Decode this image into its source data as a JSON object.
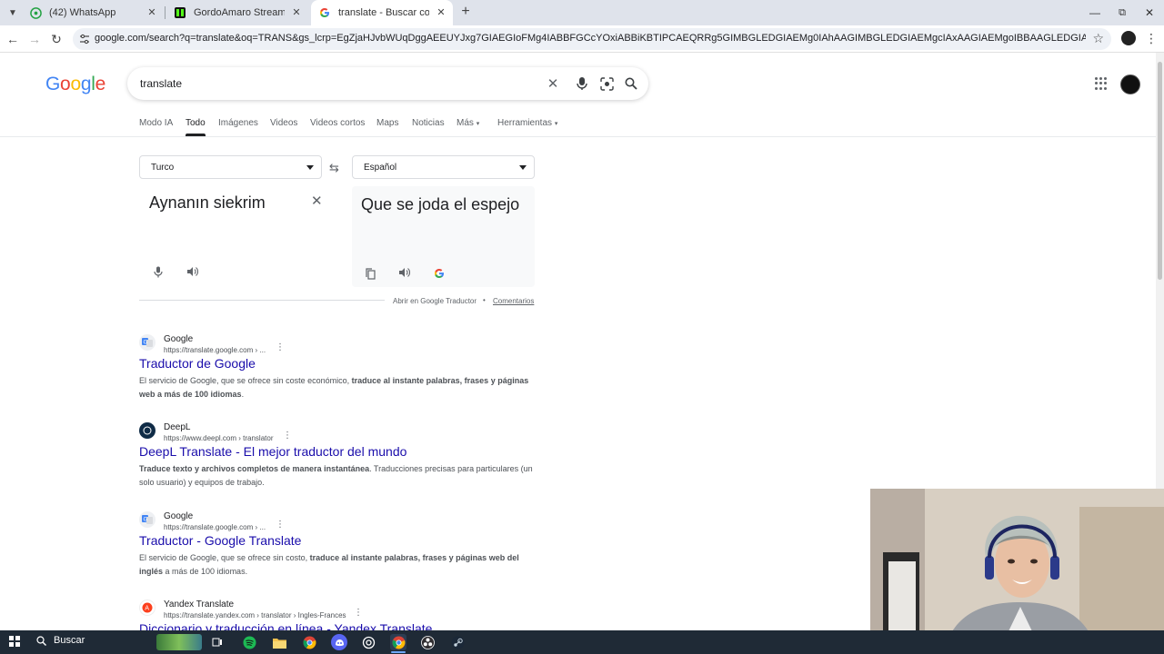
{
  "browser": {
    "tabs": [
      {
        "label": "(42) WhatsApp",
        "active": false,
        "icon": "whatsapp-icon"
      },
      {
        "label": "GordoAmaro Stream - Watch Li",
        "active": false,
        "icon": "kick-icon"
      },
      {
        "label": "translate - Buscar con Google",
        "active": true,
        "icon": "google-icon"
      }
    ],
    "url": "google.com/search?q=translate&oq=TRANS&gs_lcrp=EgZjaHJvbWUqDggAEEUYJxg7GIAEGIoFMg4IABBFGCcYOxiABBiKBTIPCAEQRRg5GIMBGLEDGIAEMg0IAhAAGIMBGLEDGIAEMgcIAxAAGIAEMgoIBBAAGLEDGIAEMgYIBRBFGD0yBggGEEUYPDIGCAcQRRg80gEHO..."
  },
  "google": {
    "logo": "Google",
    "query": "translate",
    "nav_tabs": [
      "Modo IA",
      "Todo",
      "Imágenes",
      "Videos",
      "Videos cortos",
      "Maps",
      "Noticias",
      "Más",
      "Herramientas"
    ],
    "selected_tab": "Todo"
  },
  "translator": {
    "source_lang": "Turco",
    "target_lang": "Español",
    "source_text": "Aynanın siekrim",
    "target_text": "Que se joda el espejo",
    "open_link": "Abrir en Google Traductor",
    "separator": "•",
    "comments_link": "Comentarios"
  },
  "results": [
    {
      "site": "Google",
      "url": "https://translate.google.com › ...",
      "title": "Traductor de Google",
      "snippet_parts": [
        {
          "text": "El servicio de Google, que se ofrece sin coste económico, ",
          "bold": false
        },
        {
          "text": "traduce al instante palabras, frases y páginas web a más de 100 idiomas",
          "bold": true
        },
        {
          "text": ".",
          "bold": false
        }
      ]
    },
    {
      "site": "DeepL",
      "url": "https://www.deepl.com › translator",
      "title": "DeepL Translate - El mejor traductor del mundo",
      "snippet_parts": [
        {
          "text": "Traduce texto y archivos completos de manera instantánea",
          "bold": true
        },
        {
          "text": ". Traducciones precisas para particulares (un solo usuario) y equipos de trabajo.",
          "bold": false
        }
      ]
    },
    {
      "site": "Google",
      "url": "https://translate.google.com › ...",
      "title": "Traductor - Google Translate",
      "snippet_parts": [
        {
          "text": "El servicio de Google, que se ofrece sin costo, ",
          "bold": false
        },
        {
          "text": "traduce al instante palabras, frases y páginas web del inglés",
          "bold": true
        },
        {
          "text": " a más de 100 idiomas.",
          "bold": false
        }
      ]
    },
    {
      "site": "Yandex Translate",
      "url": "https://translate.yandex.com › translator › Ingles-Frances",
      "title": "Diccionario y traducción en línea - Yandex Translate",
      "snippet_parts": []
    }
  ],
  "taskbar": {
    "search_label": "Buscar",
    "apps": [
      "task-view-icon",
      "spotify-icon",
      "file-explorer-icon",
      "chrome-icon",
      "discord-icon",
      "chatgpt-icon",
      "chrome-active-icon",
      "obs-icon",
      "steam-icon"
    ]
  },
  "colors": {
    "link": "#1a0dab",
    "taskbar": "#1f2a36",
    "tabstrip": "#dfe3eb"
  }
}
